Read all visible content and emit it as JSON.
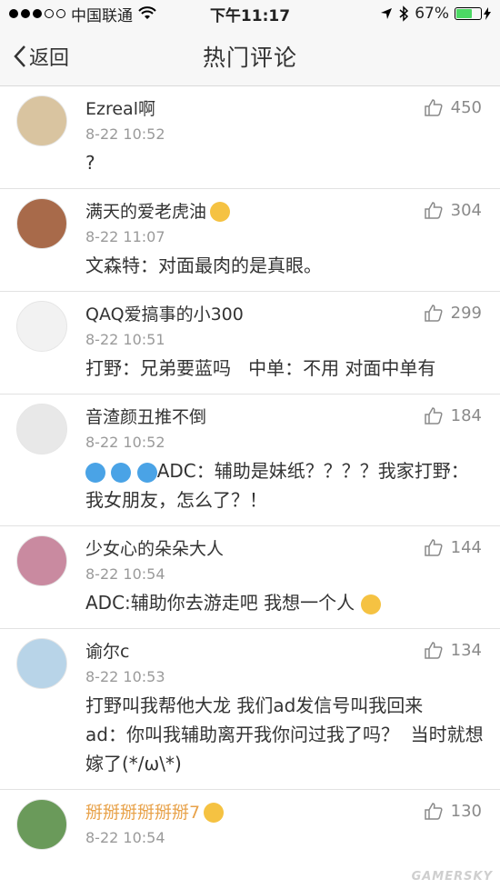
{
  "status_bar": {
    "carrier": "中国联通",
    "time": "下午11:17",
    "battery": "67%",
    "battery_level": 0.67
  },
  "nav": {
    "back_label": "返回",
    "title": "热门评论"
  },
  "comments": [
    {
      "name": "Ezreal啊",
      "time": "8-22 10:52",
      "likes": "450",
      "text": "?",
      "avatar_color": "#d9c4a0"
    },
    {
      "name": "满天的爱老虎油",
      "time": "8-22 11:07",
      "likes": "304",
      "text": "文森特：对面最肉的是真眼。",
      "avatar_color": "#a86a4a"
    },
    {
      "name": "QAQ爱搞事的小300",
      "time": "8-22 10:51",
      "likes": "299",
      "text": "打野：兄弟要蓝吗   中单：不用 对面中单有",
      "avatar_color": "#f2f2f2"
    },
    {
      "name": "音渣颜丑推不倒",
      "time": "8-22 10:52",
      "likes": "184",
      "text": "ADC：辅助是妹纸？？？？我家打野：我女朋友，怎么了？！",
      "avatar_color": "#e8e8e8"
    },
    {
      "name": "少女心的朵朵大人",
      "time": "8-22 10:54",
      "likes": "144",
      "text": "ADC:辅助你去游走吧 我想一个人",
      "avatar_color": "#c98aa0"
    },
    {
      "name": "谕尔c",
      "time": "8-22 10:53",
      "likes": "134",
      "text": "打野叫我帮他大龙 我们ad发信号叫我回来\nad：你叫我辅助离开我你问过我了吗？  当时就想嫁了(*/ω\\*)",
      "avatar_color": "#b8d4e8"
    },
    {
      "name": "掰掰掰掰掰掰7",
      "time": "8-22 10:54",
      "likes": "130",
      "text": "",
      "avatar_color": "#6a9a5a"
    }
  ],
  "watermark": "GAMERSKY"
}
